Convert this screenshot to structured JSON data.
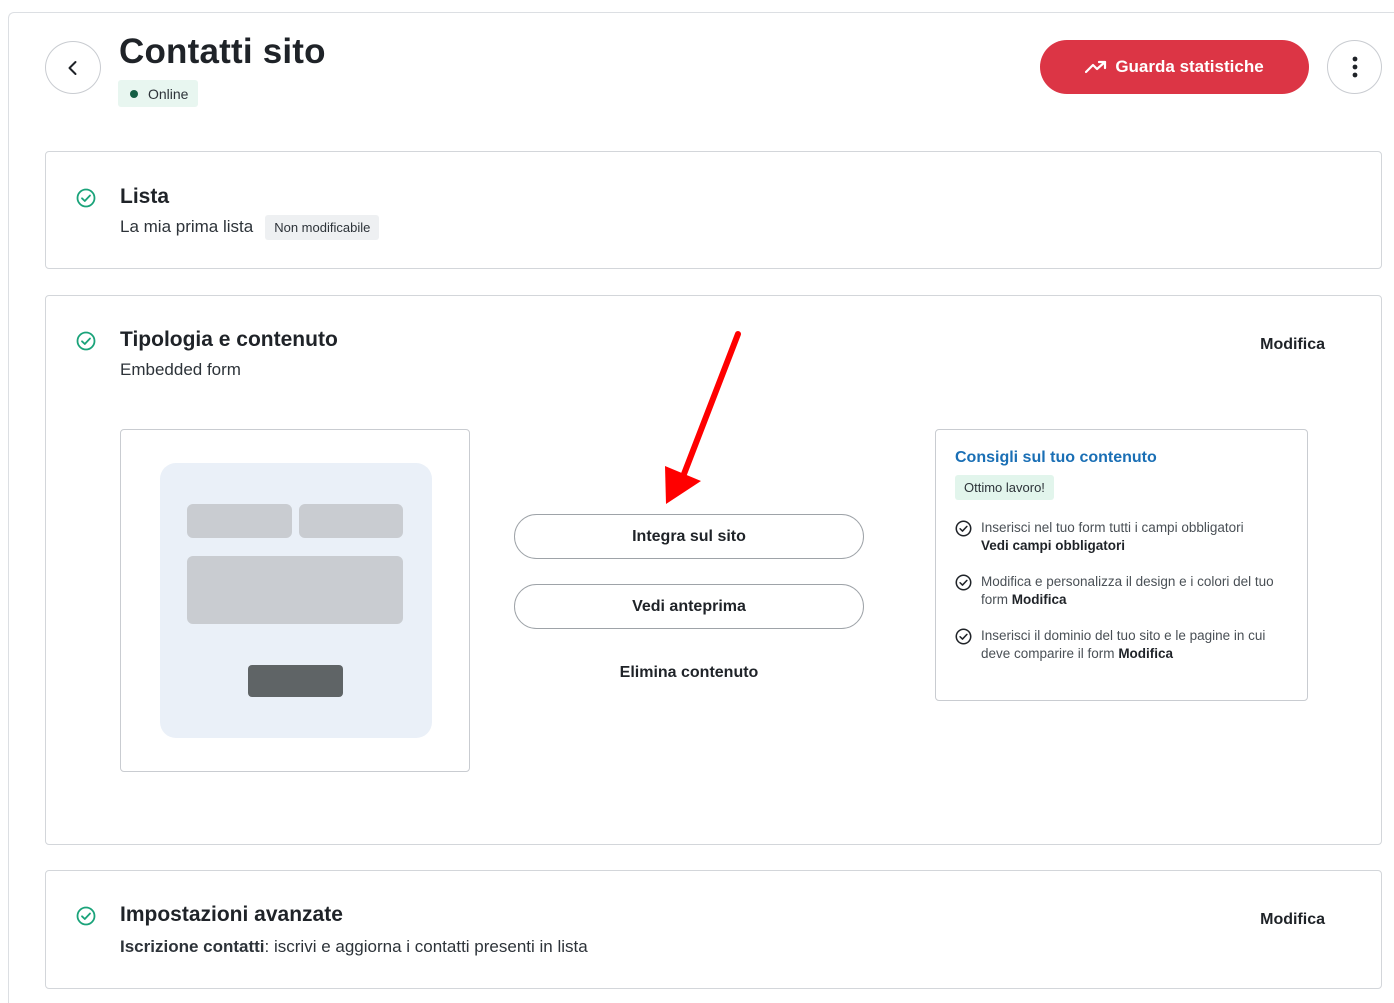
{
  "header": {
    "title": "Contatti sito",
    "status": "Online",
    "stats_button": "Guarda statistiche"
  },
  "lista": {
    "title": "Lista",
    "value": "La mia prima lista",
    "badge": "Non modificabile"
  },
  "tipologia": {
    "title": "Tipologia e contenuto",
    "subtitle": "Embedded form",
    "edit_label": "Modifica",
    "integrate_button": "Integra sul sito",
    "preview_button": "Vedi anteprima",
    "delete_label": "Elimina contenuto",
    "tips": {
      "title": "Consigli sul tuo contenuto",
      "badge": "Ottimo lavoro!",
      "items": [
        {
          "text": "Inserisci nel tuo form tutti i campi obbligatori",
          "link": "Vedi campi obbligatori"
        },
        {
          "text": "Modifica e personalizza il design e i colori del tuo form",
          "link": "Modifica"
        },
        {
          "text": "Inserisci il dominio del tuo sito e le pagine in cui deve comparire il form",
          "link": "Modifica"
        }
      ]
    }
  },
  "impostazioni": {
    "title": "Impostazioni avanzate",
    "label": "Iscrizione contatti",
    "description": ": iscrivi e aggiorna i contatti presenti in lista",
    "edit_label": "Modifica"
  },
  "colors": {
    "accent": "#dc3545",
    "success": "#1aa37a",
    "link": "#1a6fb5",
    "annotation_arrow": "#ff0000"
  }
}
